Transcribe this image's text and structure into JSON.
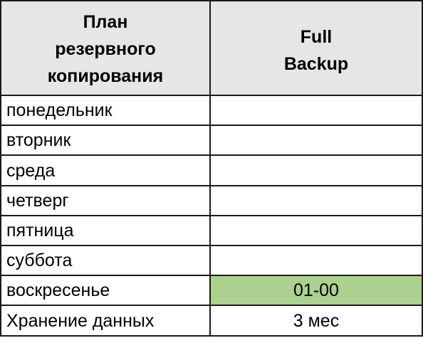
{
  "table": {
    "headers": {
      "plan": "План\nрезервного\nкопирования",
      "backup_type": "Full\nBackup"
    },
    "rows": [
      {
        "day": "понедельник",
        "value": ""
      },
      {
        "day": "вторник",
        "value": ""
      },
      {
        "day": "среда",
        "value": ""
      },
      {
        "day": "четверг",
        "value": ""
      },
      {
        "day": "пятница",
        "value": ""
      },
      {
        "day": "суббота",
        "value": ""
      },
      {
        "day": "воскресенье",
        "value": "01-00"
      }
    ],
    "retention": {
      "label": "Хранение данных",
      "value": "3 мес"
    }
  },
  "colors": {
    "header_fill": "#e7e6e6",
    "scheduled_fill": "#acd08f",
    "border": "#1a1a1a"
  }
}
